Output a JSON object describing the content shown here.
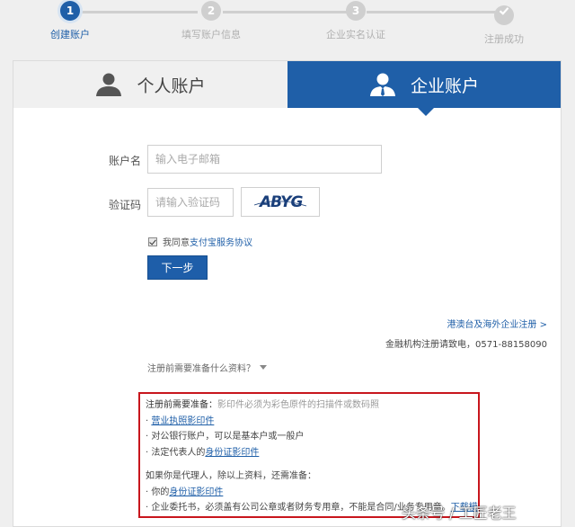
{
  "stepper": {
    "steps": [
      {
        "number": "1",
        "label": "创建账户",
        "state": "active"
      },
      {
        "number": "2",
        "label": "填写账户信息",
        "state": "pending"
      },
      {
        "number": "3",
        "label": "企业实名认证",
        "state": "pending"
      },
      {
        "number": "",
        "label": "注册成功",
        "state": "pending",
        "icon": "check-icon"
      }
    ]
  },
  "tabs": {
    "personal": {
      "label": "个人账户",
      "icon": "person-icon"
    },
    "enterprise": {
      "label": "企业账户",
      "icon": "business-person-icon",
      "selected": true
    }
  },
  "form": {
    "account": {
      "label": "账户名",
      "placeholder": "输入电子邮箱",
      "value": ""
    },
    "captcha": {
      "label": "验证码",
      "placeholder": "请输入验证码",
      "value": "",
      "image_text": "ABYG"
    },
    "agreement": {
      "checked": true,
      "prefix": "我同意",
      "link": "支付宝服务协议"
    },
    "next_button": "下一步"
  },
  "links": {
    "overseas": "港澳台及海外企业注册 >",
    "finance_hotline": "金融机构注册请致电，0571-88158090"
  },
  "materials_toggle": "注册前需要准备什么资料？",
  "materials": {
    "heading": "注册前需要准备：",
    "heading_note": "影印件必须为彩色原件的扫描件或数码照",
    "items": [
      {
        "bullet": "· ",
        "link": "营业执照影印件",
        "text": ""
      },
      {
        "bullet": "· ",
        "text": "对公银行账户，可以是基本户或一般户"
      },
      {
        "bullet": "· ",
        "text": "法定代表人的",
        "link": "身份证影印件"
      }
    ],
    "agent_heading": "如果你是代理人，除以上资料，还需准备：",
    "agent_items": [
      {
        "bullet": "· ",
        "text": "你的",
        "link": "身份证影印件"
      },
      {
        "bullet": "· ",
        "text": "企业委托书，必须盖有公司公章或者财务专用章，不能是合同/业务专用章。",
        "link": "下载模板"
      }
    ]
  },
  "watermark": "头条号 / 工匠老王",
  "colors": {
    "accent": "#1f5fa8",
    "highlight_border": "#c8161d",
    "inactive": "#cfcfcf"
  }
}
